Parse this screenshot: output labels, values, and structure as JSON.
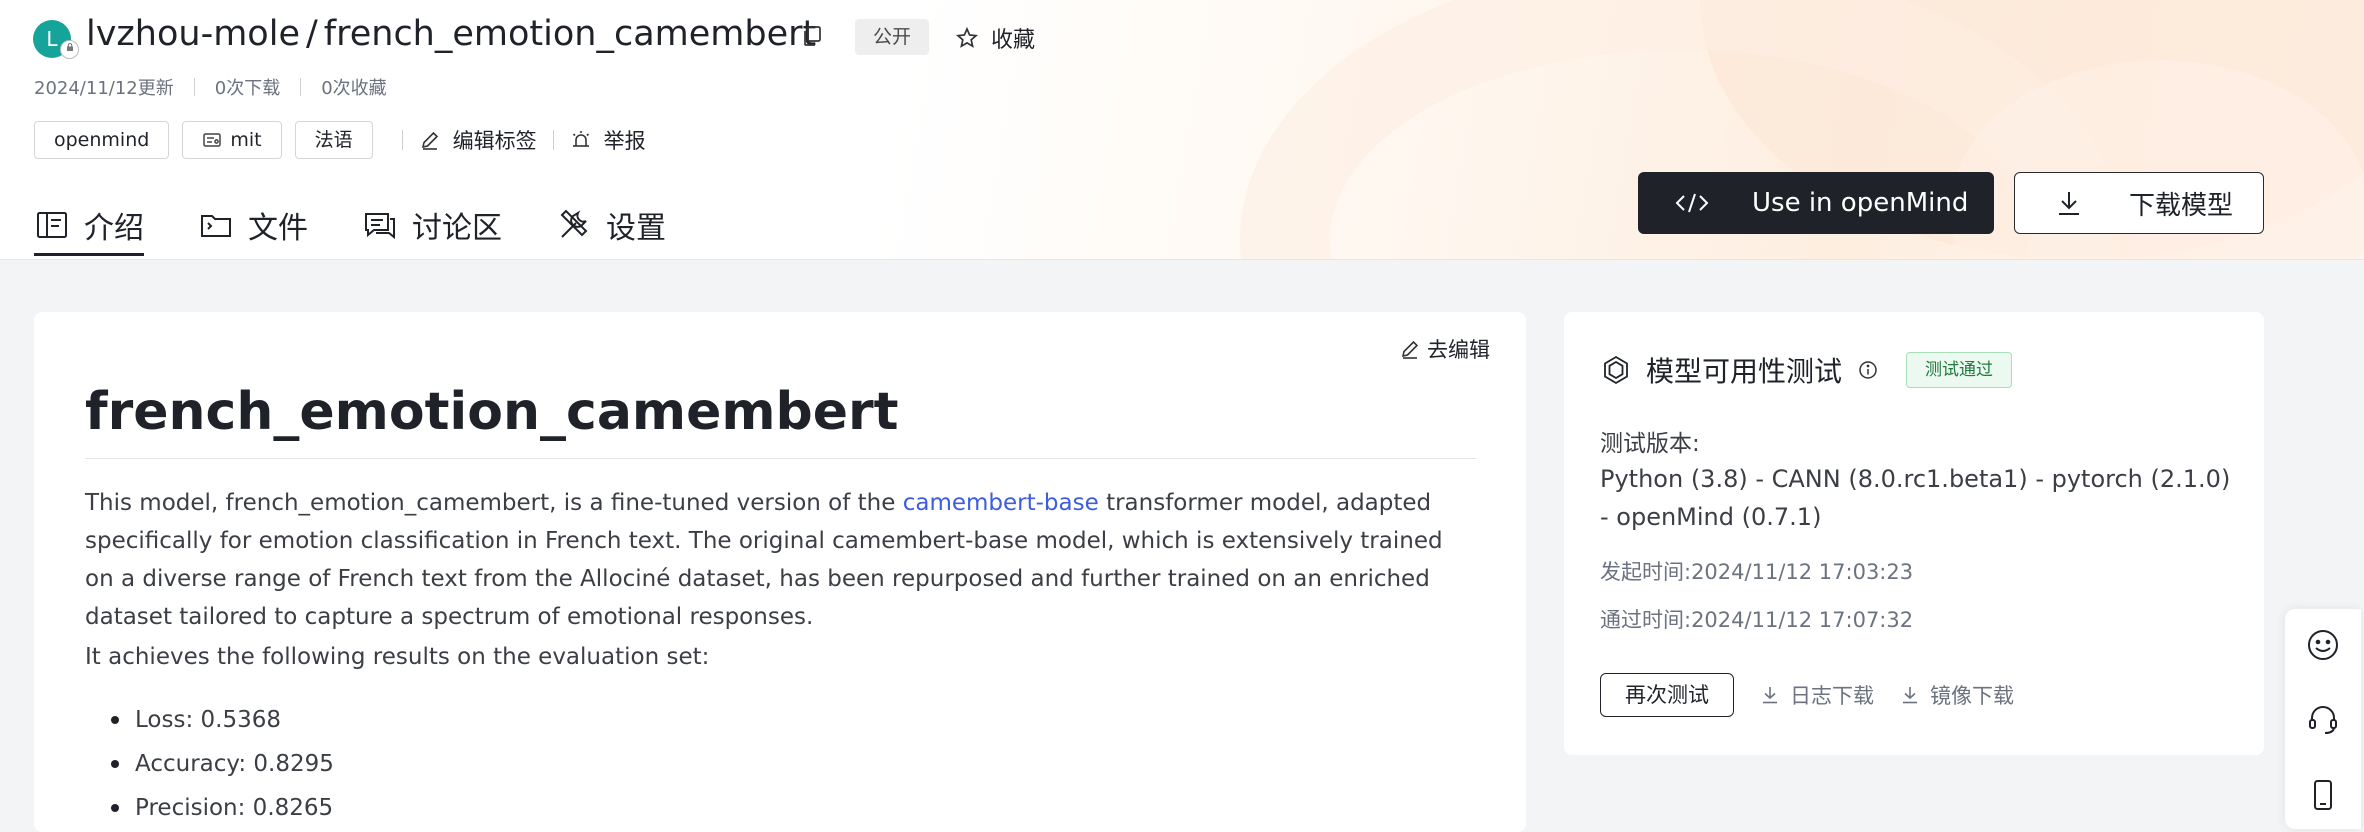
{
  "repo": {
    "owner": "lvzhou-mole",
    "separator": "/",
    "name": "french_emotion_camembert",
    "avatar_letter": "L",
    "visibility": "公开",
    "favorite_label": "收藏"
  },
  "meta": {
    "updated": "2024/11/12更新",
    "downloads": "0次下载",
    "favorites": "0次收藏"
  },
  "tags": [
    "openmind",
    "mit",
    "法语"
  ],
  "tag_actions": {
    "edit_tags": "编辑标签",
    "report": "举报"
  },
  "tabs": [
    {
      "label": "介绍",
      "icon": "book-icon",
      "active": true
    },
    {
      "label": "文件",
      "icon": "folder-icon",
      "active": false
    },
    {
      "label": "讨论区",
      "icon": "chat-icon",
      "active": false
    },
    {
      "label": "设置",
      "icon": "tools-icon",
      "active": false
    }
  ],
  "actions": {
    "use_in": "Use in openMind",
    "download": "下载模型"
  },
  "readme": {
    "edit_link": "去编辑",
    "heading": "french_emotion_camembert",
    "para_before_link": "This model, french_emotion_camembert, is a fine-tuned version of the ",
    "link_text": "camembert-base",
    "para_after_link": " transformer model, adapted specifically for emotion classification in French text. The original camembert-base model, which is extensively trained on a diverse range of French text from the Allociné dataset, has been repurposed and further trained on an enriched dataset tailored to capture a spectrum of emotional responses.",
    "results_intro": "It achieves the following results on the evaluation set:",
    "results": [
      "Loss: 0.5368",
      "Accuracy: 0.8295",
      "Precision: 0.8265"
    ]
  },
  "availability": {
    "title": "模型可用性测试",
    "status": "测试通过",
    "version_label": "测试版本:",
    "version_text": "Python (3.8) - CANN (8.0.rc1.beta1) - pytorch (2.1.0) - openMind (0.7.1)",
    "start_time": "发起时间:2024/11/12 17:03:23",
    "pass_time": "通过时间:2024/11/12 17:07:32",
    "retest": "再次测试",
    "log_download": "日志下载",
    "image_download": "镜像下载"
  },
  "colors": {
    "accent_link": "#3d5ce0",
    "dark_button": "#1f2329",
    "pass_green": "#1f7a3c",
    "avatar_teal": "#16a39a"
  }
}
